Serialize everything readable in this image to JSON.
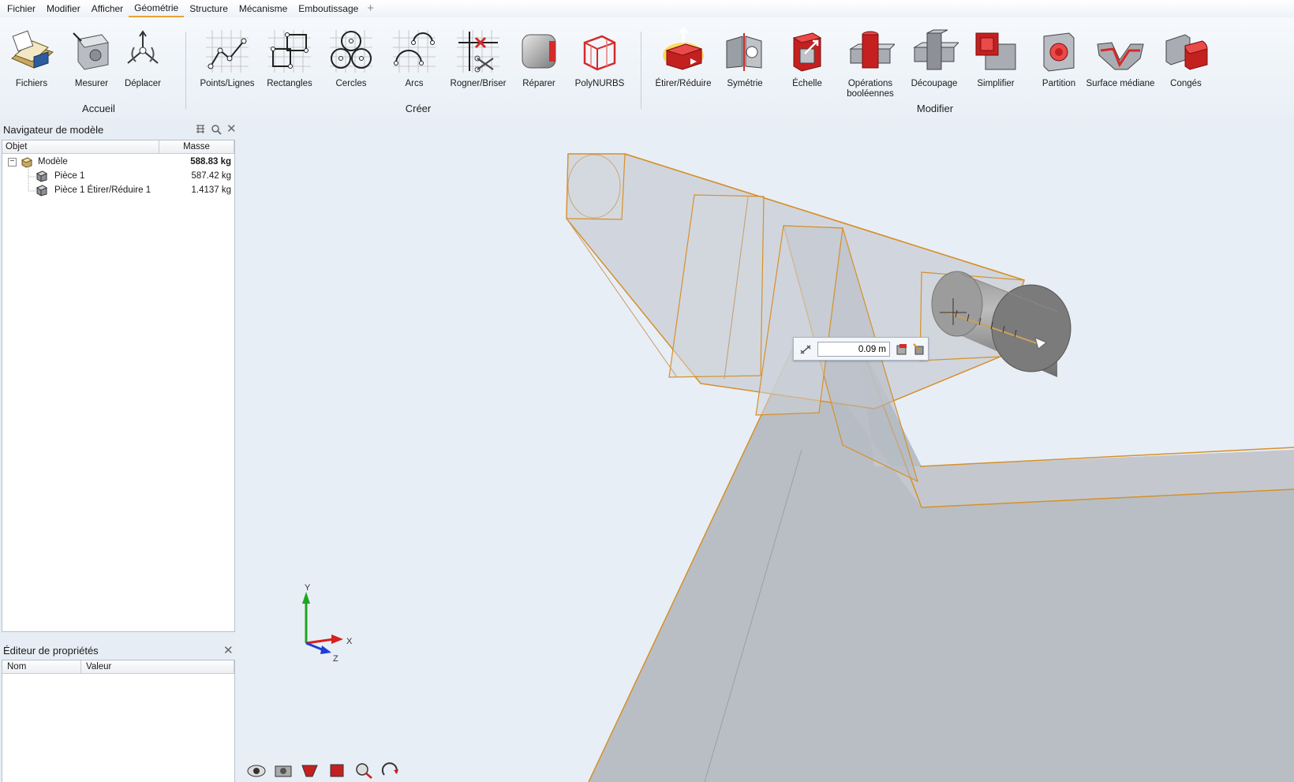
{
  "menu": {
    "items": [
      "Fichier",
      "Modifier",
      "Afficher",
      "Géométrie",
      "Structure",
      "Mécanisme",
      "Emboutissage"
    ],
    "active": "Géométrie",
    "add_symbol": "+"
  },
  "ribbon": {
    "groups": {
      "accueil": "Accueil",
      "creer": "Créer",
      "modifier": "Modifier"
    },
    "buttons": {
      "fichiers": "Fichiers",
      "mesurer": "Mesurer",
      "deplacer": "Déplacer",
      "points_lignes": "Points/Lignes",
      "rectangles": "Rectangles",
      "cercles": "Cercles",
      "arcs": "Arcs",
      "rogner": "Rogner/Briser",
      "reparer": "Réparer",
      "polynurbs": "PolyNURBS",
      "etirer": "Étirer/Réduire",
      "symetrie": "Symétrie",
      "echelle": "Échelle",
      "booleennes_1": "Opérations",
      "booleennes_2": "booléennes",
      "decoupage": "Découpage",
      "simplifier": "Simplifier",
      "partition": "Partition",
      "surface_mediane": "Surface médiane",
      "conges": "Congés"
    }
  },
  "navigator": {
    "title": "Navigateur de modèle",
    "col_object": "Objet",
    "col_mass": "Masse",
    "rows": [
      {
        "name": "Modèle",
        "mass": "588.83 kg"
      },
      {
        "name": "Pièce 1",
        "mass": "587.42 kg"
      },
      {
        "name": "Pièce 1 Étirer/Réduire 1",
        "mass": "1.4137 kg"
      }
    ],
    "expander": "−"
  },
  "properties": {
    "title": "Éditeur de propriétés",
    "col_name": "Nom",
    "col_value": "Valeur"
  },
  "close_symbol": "✕",
  "dimension": {
    "value": "0.09 m"
  },
  "axes": {
    "x": "X",
    "y": "Y",
    "z": "Z"
  },
  "colors": {
    "highlight_edge": "#d6902a",
    "accent_red": "#d42a2a",
    "axis_x": "#d62020",
    "axis_y": "#1fa51f",
    "axis_z": "#1f3ed6"
  }
}
